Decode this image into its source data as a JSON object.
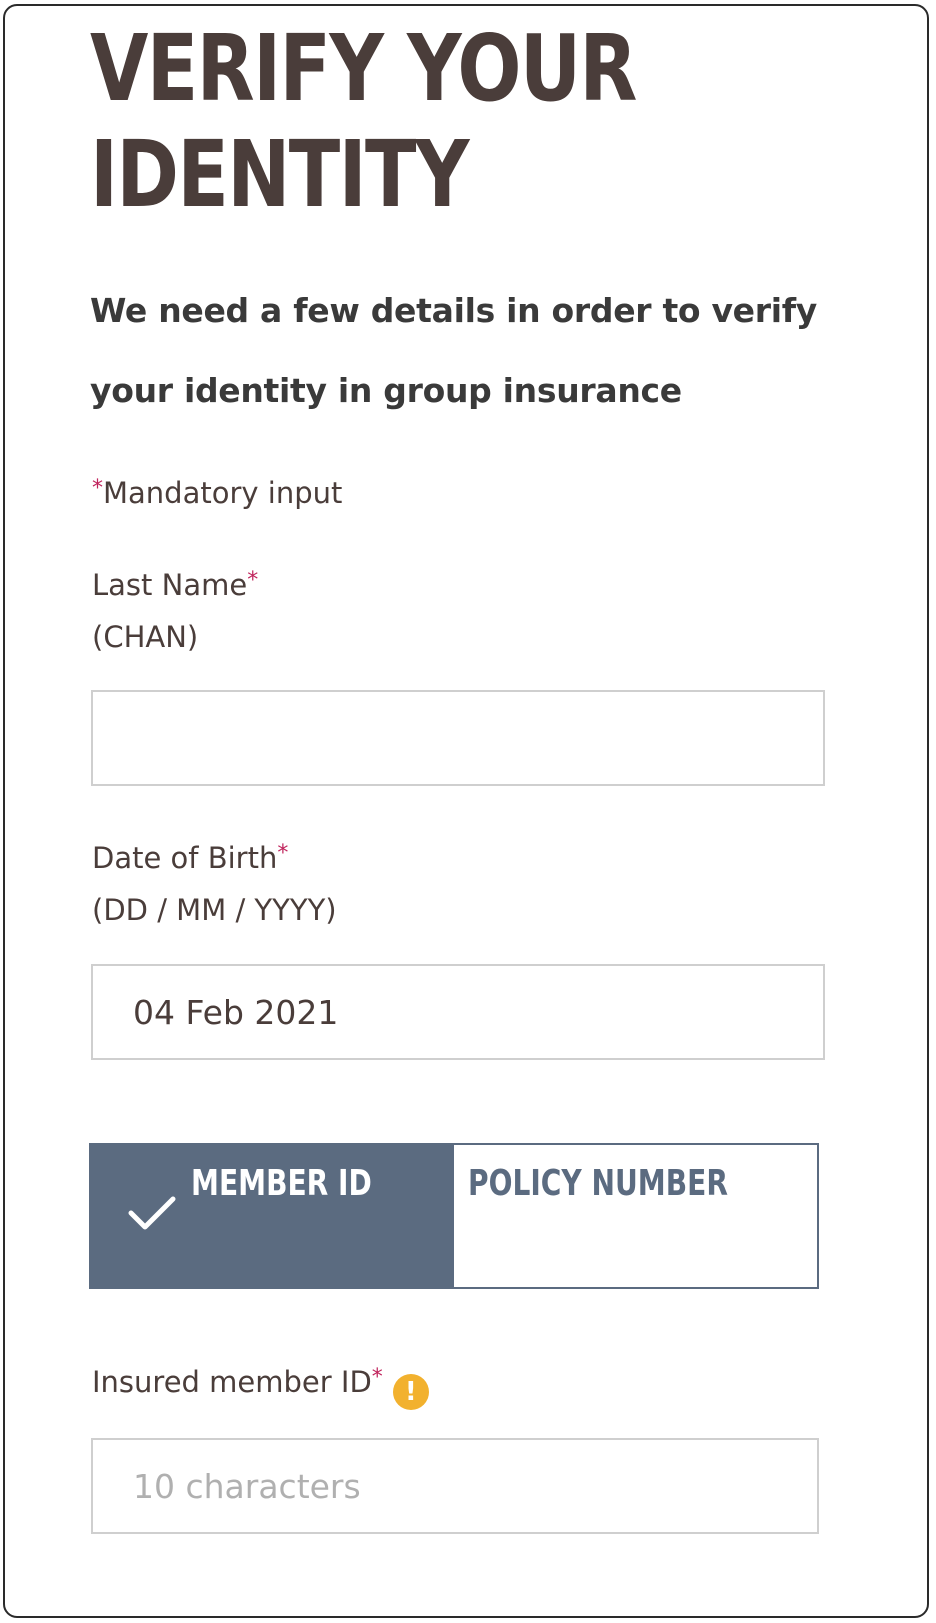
{
  "header": {
    "title_line1": "VERIFY YOUR",
    "title_line2": "IDENTITY",
    "subtitle": "We need a few details in order to verify your identity in group insurance"
  },
  "form": {
    "mandatory_star": "*",
    "mandatory_text": "Mandatory input",
    "last_name": {
      "label": "Last Name",
      "hint": "(CHAN)",
      "value": ""
    },
    "dob": {
      "label": "Date of Birth",
      "hint": "(DD / MM / YYYY)",
      "value": "04 Feb 2021"
    },
    "id_toggle": {
      "options": [
        "MEMBER ID",
        "POLICY NUMBER"
      ],
      "selected": "MEMBER ID"
    },
    "member_id": {
      "label": "Insured member ID",
      "info_icon": "warning-icon",
      "info_glyph": "!",
      "placeholder": "10 characters",
      "value": ""
    }
  },
  "colors": {
    "title": "#4a3d3a",
    "required": "#c0245c",
    "toggle_active": "#5b6b80",
    "warning": "#f2b12e"
  }
}
